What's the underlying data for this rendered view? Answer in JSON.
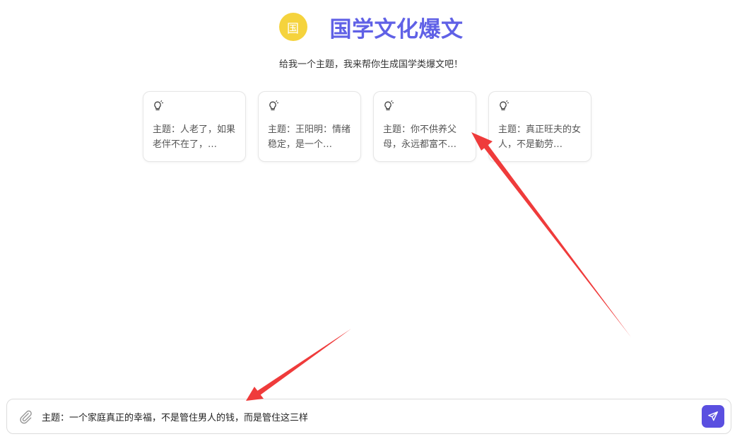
{
  "header": {
    "logo_char": "国",
    "title": "国学文化爆文",
    "subtitle": "给我一个主题，我来帮你生成国学类爆文吧！"
  },
  "suggestions": [
    {
      "text": "主题：人老了，如果老伴不在了，…",
      "icon": "lightbulb-icon"
    },
    {
      "text": "主题：王阳明：情绪稳定，是一个…",
      "icon": "lightbulb-icon"
    },
    {
      "text": "主题：你不供养父母，永远都富不…",
      "icon": "lightbulb-icon"
    },
    {
      "text": "主题：真正旺夫的女人，不是勤劳…",
      "icon": "lightbulb-icon"
    }
  ],
  "input": {
    "value": "主题：一个家庭真正的幸福，不是管住男人的钱，而是管住这三样",
    "attach_icon": "paperclip-icon",
    "send_icon": "send-icon"
  },
  "colors": {
    "title": "#6061e6",
    "logo_bg": "#f5d33d",
    "send_bg": "#5a4fe0",
    "annotation_arrow": "#ef3b3b"
  }
}
